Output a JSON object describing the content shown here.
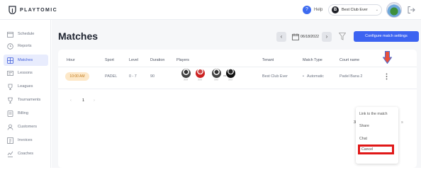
{
  "brand": {
    "name": "PLAYTOMIC"
  },
  "header": {
    "help_label": "Help",
    "club_badge": "B",
    "club_name": "Best Club Ever"
  },
  "sidebar": {
    "items": [
      {
        "label": "Schedule",
        "icon": "calendar-icon",
        "active": false
      },
      {
        "label": "Reports",
        "icon": "clock-icon",
        "active": false
      },
      {
        "label": "Matches",
        "icon": "matches-icon",
        "active": true
      },
      {
        "label": "Lessons",
        "icon": "lessons-icon",
        "active": false
      },
      {
        "label": "Leagues",
        "icon": "trophy-icon",
        "active": false
      },
      {
        "label": "Tournaments",
        "icon": "cup-icon",
        "active": false
      },
      {
        "label": "Billing",
        "icon": "billing-icon",
        "active": false
      },
      {
        "label": "Customers",
        "icon": "customers-icon",
        "active": false
      },
      {
        "label": "Invoices",
        "icon": "invoices-icon",
        "active": false
      },
      {
        "label": "Coaches",
        "icon": "coaches-icon",
        "active": false
      }
    ]
  },
  "main": {
    "title": "Matches",
    "date": "06/18/2022",
    "configure_label": "Configure match settings"
  },
  "table": {
    "headers": {
      "hour": "Hour",
      "sport": "Sport",
      "level": "Level",
      "duration": "Duration",
      "players": "Players",
      "tenant": "Tenant",
      "match_type": "Match Type",
      "court": "Court name"
    },
    "row": {
      "hour": "10:00 AM",
      "sport": "PADEL",
      "level": "0 - 7",
      "duration": "90",
      "players": [
        {
          "level": "???"
        },
        {
          "level": "???"
        },
        {
          "level": "???"
        },
        {
          "level": "???"
        }
      ],
      "vs": "vs",
      "tenant": "Best Club Ever",
      "match_type": "Automatic",
      "court": "Padel Bana 2"
    }
  },
  "pagination": {
    "page": "1",
    "page_size": "30",
    "page_size_tail": "s"
  },
  "menu": {
    "items": [
      "Link to the match",
      "Share",
      "Chat",
      "Cancel"
    ]
  },
  "colors": {
    "accent": "#3c63f1",
    "highlight": "#e01818",
    "time_badge": "#fde8c8"
  }
}
